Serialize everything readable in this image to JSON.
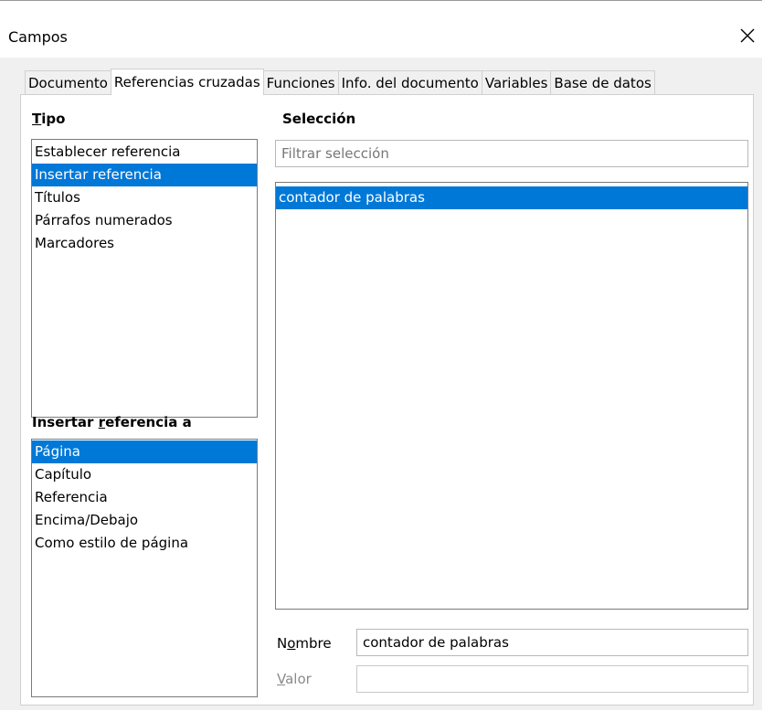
{
  "window": {
    "title": "Campos",
    "close_glyph": "✕"
  },
  "tabs": [
    {
      "label": "Documento",
      "active": false
    },
    {
      "label": "Referencias cruzadas",
      "active": true
    },
    {
      "label": "Funciones",
      "active": false
    },
    {
      "label": "Info. del documento",
      "active": false
    },
    {
      "label": "Variables",
      "active": false
    },
    {
      "label": "Base de datos",
      "active": false
    }
  ],
  "tipo": {
    "heading_first": "T",
    "heading_rest": "ipo",
    "items": [
      {
        "label": "Establecer referencia",
        "selected": false
      },
      {
        "label": "Insertar referencia",
        "selected": true
      },
      {
        "label": "Títulos",
        "selected": false
      },
      {
        "label": "Párrafos numerados",
        "selected": false
      },
      {
        "label": "Marcadores",
        "selected": false
      }
    ]
  },
  "insert_ref": {
    "heading_pre": "Insertar ",
    "heading_ul": "r",
    "heading_post": "eferencia a",
    "items": [
      {
        "label": "Página",
        "selected": true
      },
      {
        "label": "Capítulo",
        "selected": false
      },
      {
        "label": "Referencia",
        "selected": false
      },
      {
        "label": "Encima/Debajo",
        "selected": false
      },
      {
        "label": "Como estilo de página",
        "selected": false
      }
    ]
  },
  "seleccion": {
    "heading": "Selección",
    "filter_placeholder": "Filtrar selección",
    "items": [
      {
        "label": "contador de palabras",
        "selected": true
      }
    ]
  },
  "nombre": {
    "label_pre": "N",
    "label_ul": "o",
    "label_post": "mbre",
    "value": "contador de palabras"
  },
  "valor": {
    "label_ul": "V",
    "label_post": "alor",
    "value": ""
  }
}
